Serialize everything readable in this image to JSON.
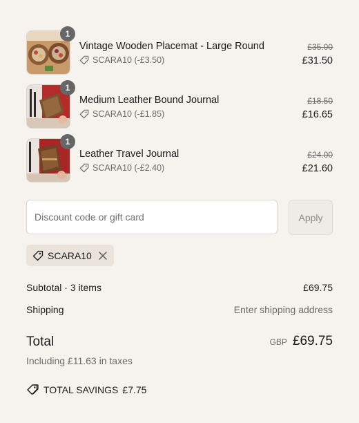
{
  "items": [
    {
      "name": "Vintage Wooden Placemat - Large Round",
      "quantity": "1",
      "discount": "SCARA10 (-£3.50)",
      "original_price": "£35.00",
      "final_price": "£31.50",
      "image_icon": "placemat-photo"
    },
    {
      "name": "Medium Leather Bound Journal",
      "quantity": "1",
      "discount": "SCARA10 (-£1.85)",
      "original_price": "£18.50",
      "final_price": "£16.65",
      "image_icon": "journal-photo"
    },
    {
      "name": "Leather Travel Journal",
      "quantity": "1",
      "discount": "SCARA10 (-£2.40)",
      "original_price": "£24.00",
      "final_price": "£21.60",
      "image_icon": "travel-journal-photo"
    }
  ],
  "discount": {
    "placeholder": "Discount code or gift card",
    "value": "",
    "apply_label": "Apply",
    "applied_code": "SCARA10"
  },
  "summary": {
    "subtotal_label": "Subtotal · 3 items",
    "subtotal_value": "£69.75",
    "shipping_label": "Shipping",
    "shipping_value": "Enter shipping address",
    "total_label": "Total",
    "currency_code": "GBP",
    "total_value": "£69.75",
    "taxes_note": "Including £11.63 in taxes",
    "savings_label": "TOTAL SAVINGS",
    "savings_value": "£7.75"
  },
  "colors": {
    "background": "#f6f3ef",
    "text": "#1a1a1a",
    "muted": "#6b6b6b",
    "badge": "#666666",
    "chip": "#e9e3dc"
  }
}
